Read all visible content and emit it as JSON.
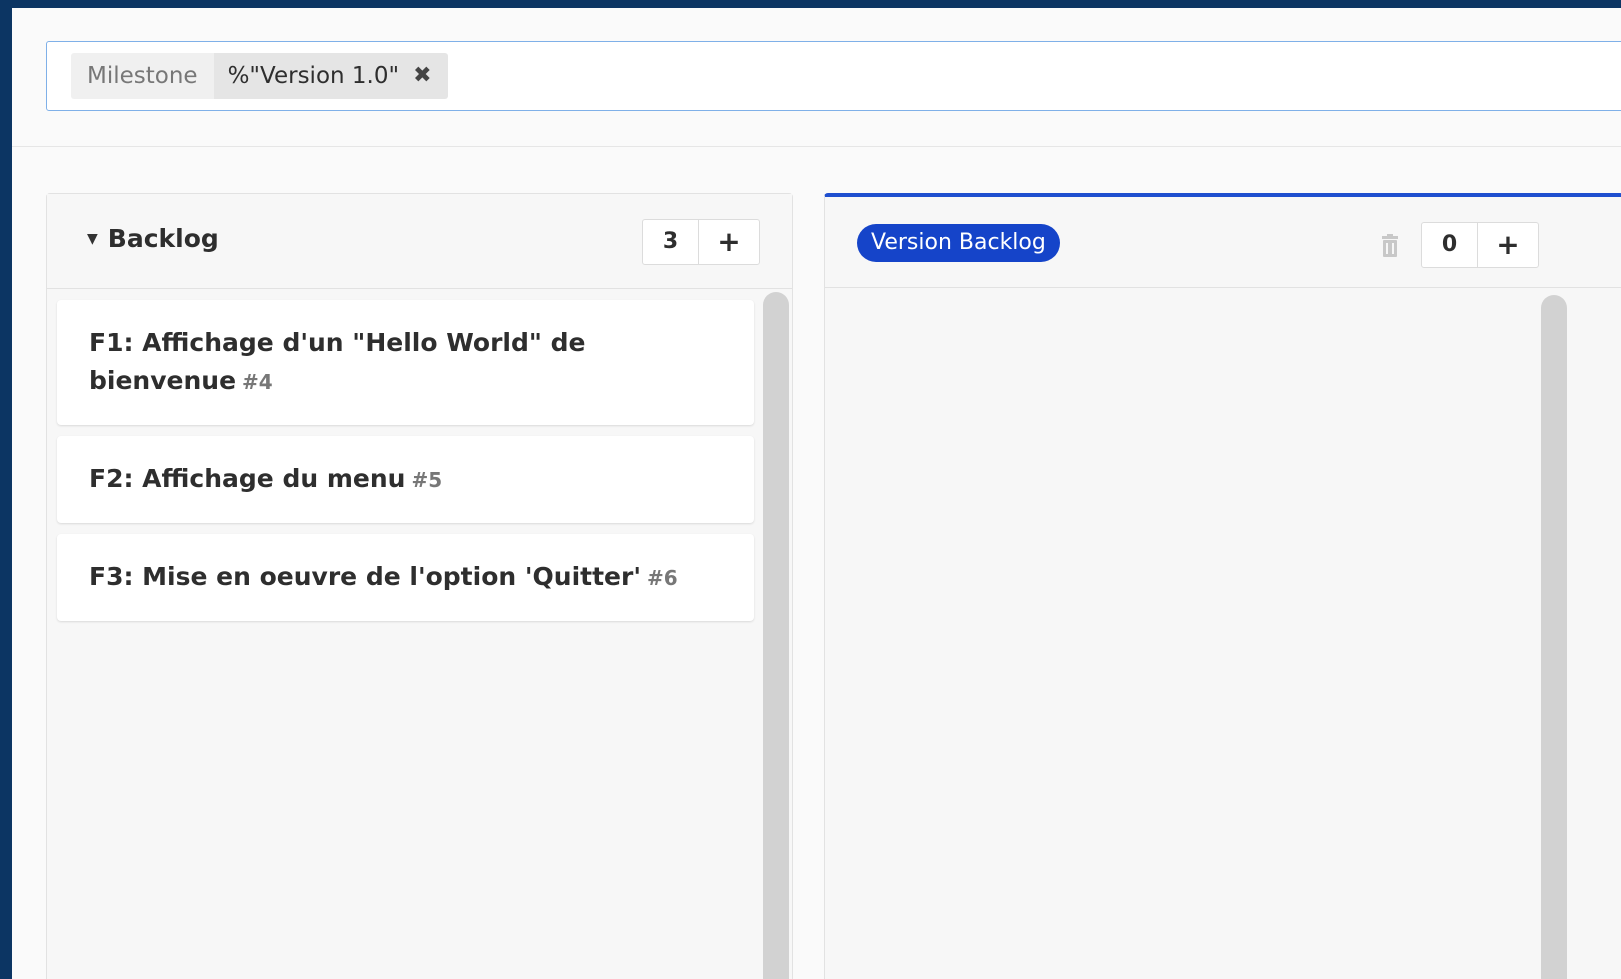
{
  "filter": {
    "token_key": "Milestone",
    "token_value": "%\"Version 1.0\"",
    "remove_glyph": "✖"
  },
  "lists": [
    {
      "title": "Backlog",
      "caret": "▼",
      "count": "3",
      "add_glyph": "+",
      "cards": [
        {
          "title": "F1: Affichage d'un \"Hello World\" de bienvenue",
          "number": "#4"
        },
        {
          "title": "F2: Affichage du menu",
          "number": "#5"
        },
        {
          "title": "F3: Mise en oeuvre de l'option 'Quitter'",
          "number": "#6"
        }
      ]
    },
    {
      "label": "Version Backlog",
      "label_color": "#1544c9",
      "count": "0",
      "add_glyph": "+",
      "icon": "trash-icon",
      "cards": []
    }
  ],
  "colors": {
    "frame": "#0c3563",
    "accent": "#1f4fcf"
  }
}
